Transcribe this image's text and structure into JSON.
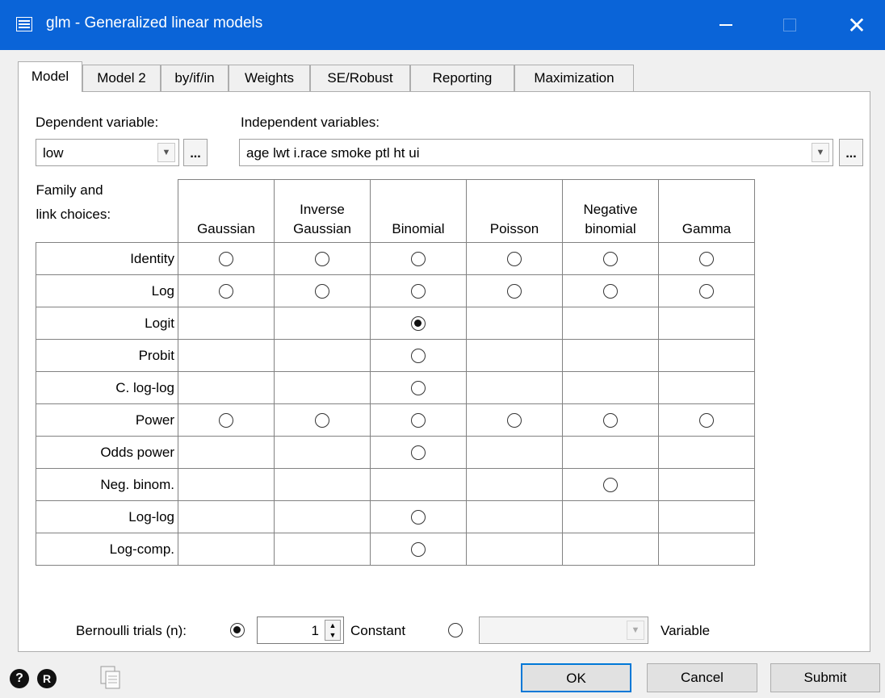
{
  "window": {
    "title": "glm - Generalized linear models"
  },
  "tabs": [
    "Model",
    "Model 2",
    "by/if/in",
    "Weights",
    "SE/Robust",
    "Reporting",
    "Maximization"
  ],
  "dependent": {
    "label": "Dependent variable:",
    "value": "low"
  },
  "independent": {
    "label": "Independent variables:",
    "value": "age lwt i.race smoke ptl ht ui"
  },
  "browse_label": "...",
  "grid": {
    "corner_label": [
      "Family and",
      "link choices:"
    ],
    "families": [
      [
        "Gaussian"
      ],
      [
        "Inverse",
        "Gaussian"
      ],
      [
        "Binomial"
      ],
      [
        "Poisson"
      ],
      [
        "Negative",
        "binomial"
      ],
      [
        "Gamma"
      ]
    ],
    "rows": [
      {
        "label": "Identity",
        "cells": [
          1,
          1,
          1,
          1,
          1,
          1
        ]
      },
      {
        "label": "Log",
        "cells": [
          1,
          1,
          1,
          1,
          1,
          1
        ]
      },
      {
        "label": "Logit",
        "cells": [
          0,
          0,
          2,
          0,
          0,
          0
        ]
      },
      {
        "label": "Probit",
        "cells": [
          0,
          0,
          1,
          0,
          0,
          0
        ]
      },
      {
        "label": "C. log-log",
        "cells": [
          0,
          0,
          1,
          0,
          0,
          0
        ]
      },
      {
        "label": "Power",
        "cells": [
          1,
          1,
          1,
          1,
          1,
          1
        ]
      },
      {
        "label": "Odds power",
        "cells": [
          0,
          0,
          1,
          0,
          0,
          0
        ]
      },
      {
        "label": "Neg. binom.",
        "cells": [
          0,
          0,
          0,
          0,
          1,
          0
        ]
      },
      {
        "label": "Log-log",
        "cells": [
          0,
          0,
          1,
          0,
          0,
          0
        ]
      },
      {
        "label": "Log-comp.",
        "cells": [
          0,
          0,
          1,
          0,
          0,
          0
        ]
      }
    ]
  },
  "bernoulli": {
    "label": "Bernoulli trials (n):",
    "constant_value": "1",
    "constant_label": "Constant",
    "variable_label": "Variable",
    "constant_selected": true
  },
  "footer": {
    "help_glyph": "?",
    "reset_glyph": "R",
    "ok": "OK",
    "cancel": "Cancel",
    "submit": "Submit"
  },
  "colors": {
    "titlebar": "#0a64d8",
    "default_button_border": "#0078d7"
  }
}
